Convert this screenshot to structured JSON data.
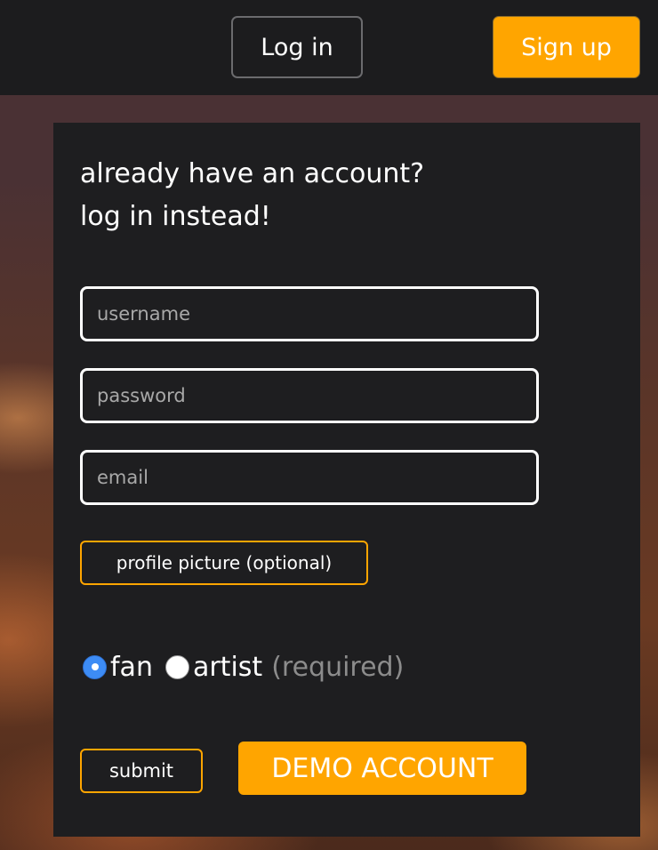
{
  "header": {
    "login_label": "Log in",
    "signup_label": "Sign up"
  },
  "form": {
    "heading_line1": "already have an account?",
    "heading_line2": "log in instead!",
    "username": {
      "value": "",
      "placeholder": "username"
    },
    "password": {
      "value": "",
      "placeholder": "password"
    },
    "email": {
      "value": "",
      "placeholder": "email"
    },
    "profile_picture_label": "profile picture (optional)",
    "roles": {
      "options": [
        "fan",
        "artist"
      ],
      "selected": "fan",
      "note": "(required)"
    },
    "submit_label": "submit",
    "demo_label": "DEMO ACCOUNT"
  },
  "colors": {
    "accent": "#ffa500",
    "panel": "#1e1e20",
    "topbar": "#1c1c1e",
    "radio_selected": "#3d8cf5"
  }
}
